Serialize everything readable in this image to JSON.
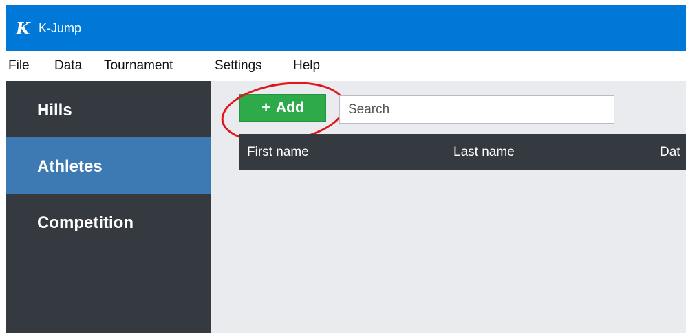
{
  "titlebar": {
    "app_icon_glyph": "K",
    "title": "K-Jump"
  },
  "menu": [
    {
      "label": "File"
    },
    {
      "label": "Data"
    },
    {
      "label": "Tournament"
    },
    {
      "label": "Settings"
    },
    {
      "label": "Help"
    }
  ],
  "sidebar": {
    "items": [
      {
        "label": "Hills",
        "active": false
      },
      {
        "label": "Athletes",
        "active": true
      },
      {
        "label": "Competition",
        "active": false
      }
    ]
  },
  "toolbar": {
    "add_icon": "+",
    "add_label": "Add",
    "search_placeholder": "Search"
  },
  "table": {
    "columns": [
      "First name",
      "Last name",
      "Dat"
    ]
  },
  "colors": {
    "titlebar": "#0078d7",
    "sidebar": "#343a40",
    "sidebar_active": "#3d7ab3",
    "add_button": "#2eaa4a",
    "highlight_ring": "#e0161b"
  }
}
